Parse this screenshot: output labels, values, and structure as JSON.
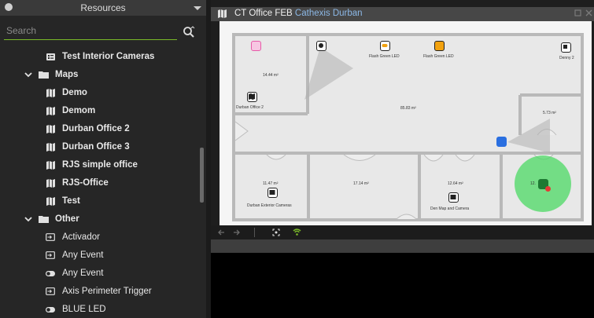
{
  "sidebar": {
    "title": "Resources",
    "search": {
      "placeholder": "Search",
      "value": ""
    },
    "items": [
      {
        "label": "Test Interior Cameras",
        "type": "camera-group",
        "level": 2
      },
      {
        "label": "Maps",
        "type": "folder",
        "level": 1,
        "expanded": true
      },
      {
        "label": "Demo",
        "type": "map",
        "level": 2
      },
      {
        "label": "Demom",
        "type": "map",
        "level": 2
      },
      {
        "label": "Durban Office 2",
        "type": "map",
        "level": 2
      },
      {
        "label": "Durban Office 3",
        "type": "map",
        "level": 2
      },
      {
        "label": "RJS simple office",
        "type": "map",
        "level": 2
      },
      {
        "label": "RJS-Office",
        "type": "map",
        "level": 2
      },
      {
        "label": "Test",
        "type": "map",
        "level": 2
      },
      {
        "label": "Other",
        "type": "folder",
        "level": 1,
        "expanded": true
      },
      {
        "label": "Activador",
        "type": "event",
        "level": 2
      },
      {
        "label": "Any Event",
        "type": "event",
        "level": 2
      },
      {
        "label": "Any Event",
        "type": "toggle",
        "level": 2
      },
      {
        "label": "Axis Perimeter Trigger",
        "type": "event",
        "level": 2
      },
      {
        "label": "BLUE LED",
        "type": "toggle",
        "level": 2
      }
    ]
  },
  "map_panel": {
    "title": "CT Office FEB",
    "subtitle": "Cathexis Durban",
    "rooms": [
      {
        "area": "14.44 m²"
      },
      {
        "area": "85.83 m²"
      },
      {
        "area": "5.73 m²"
      },
      {
        "area": "11.47 m²"
      },
      {
        "area": "17.14 m²"
      },
      {
        "area": "12.64 m²"
      },
      {
        "area": "12."
      }
    ],
    "devices": [
      {
        "label": "Flash Green LED",
        "icon": "led-icon"
      },
      {
        "label": "Flash Green LED",
        "icon": "led-icon"
      },
      {
        "label": "Denny 2",
        "icon": "printer-icon"
      },
      {
        "label": "Durban Office 2",
        "icon": "map-icon"
      },
      {
        "label": "Durban Exterior Cameras",
        "icon": "camera-group-icon"
      },
      {
        "label": "Den Map and Camera",
        "icon": "camera-group-icon"
      }
    ]
  },
  "colors": {
    "accent": "#7ab929",
    "panel_bg": "#262626",
    "header_bg": "#474747",
    "title_link": "#8cb8e6",
    "camera_blue": "#2a6fe0",
    "alarm_green": "#4cd964",
    "led_pink": "#e65aa8",
    "led_orange": "#f2a20f"
  }
}
